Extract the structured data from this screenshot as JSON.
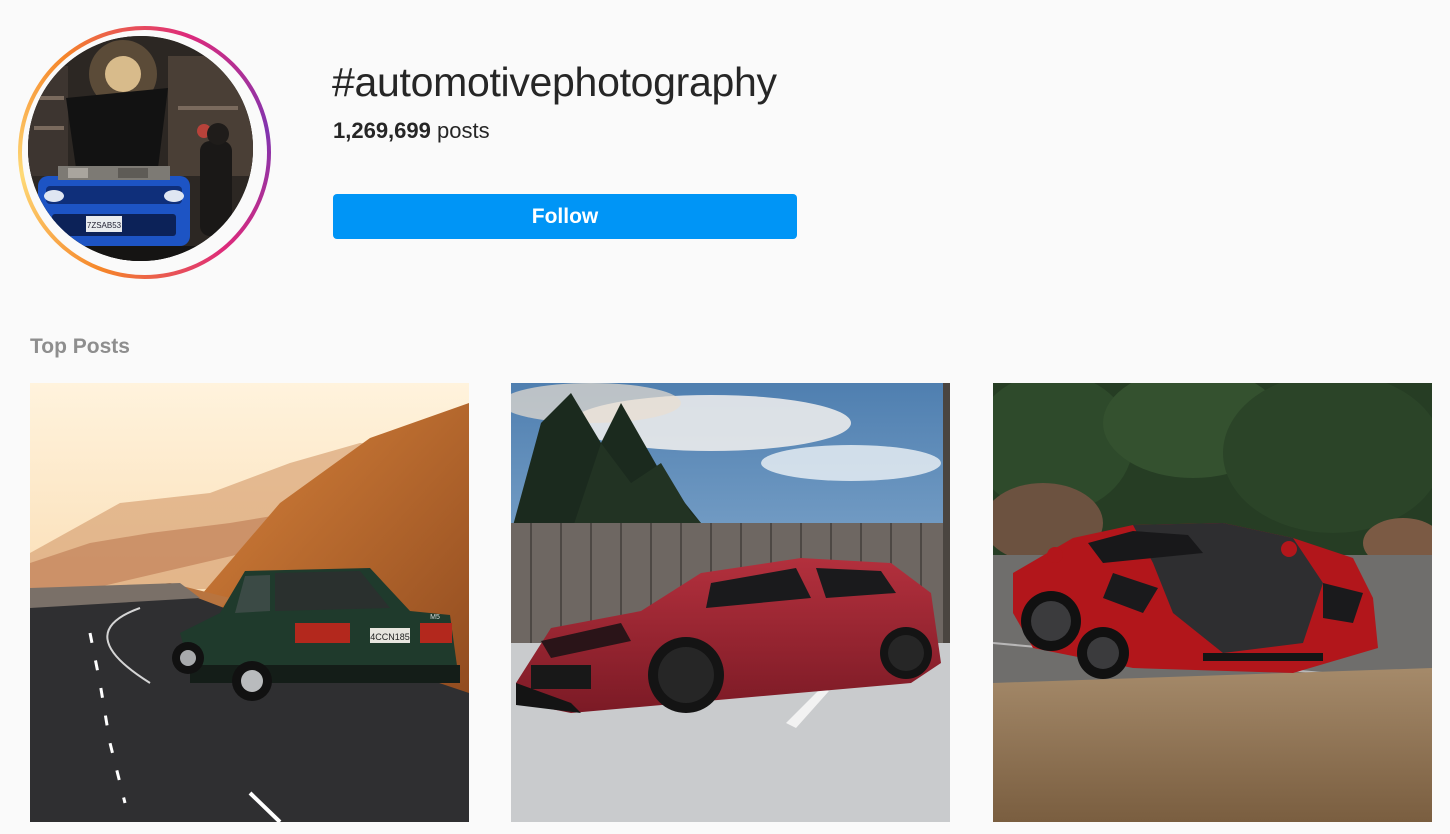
{
  "header": {
    "hashtag": "#automotivephotography",
    "post_count": "1,269,699",
    "post_count_suffix": " posts",
    "follow_label": "Follow"
  },
  "avatar": {
    "plate_text": "7ZSAB53"
  },
  "section": {
    "top_posts_label": "Top Posts"
  },
  "posts": [
    {
      "plate_text": "4CCN185",
      "badge": "M5"
    },
    {
      "plate_text": ""
    },
    {
      "plate_text": ""
    }
  ],
  "colors": {
    "accent": "#0095f6",
    "background": "#fafafa",
    "muted_text": "#8e8e8e",
    "ring_gradient": [
      "#f58529",
      "#dd2a7b",
      "#8134af"
    ]
  }
}
